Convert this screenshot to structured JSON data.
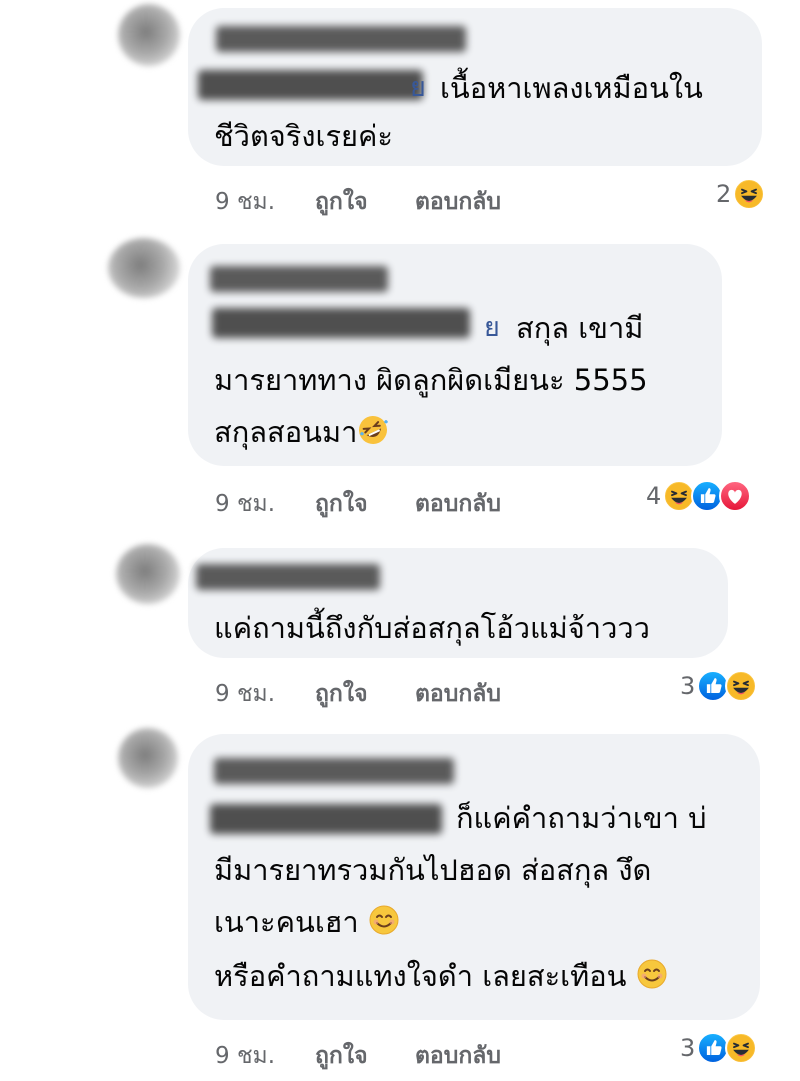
{
  "comments": [
    {
      "mention_tail": "ย",
      "lines": [
        "เนื้อหาเพลงเหมือนใน",
        "ชีวิตจริงเรยค่ะ"
      ],
      "time": "9 ชม.",
      "like_label": "ถูกใจ",
      "reply_label": "ตอบกลับ",
      "reaction_count": "2",
      "reactions": [
        "haha-icon"
      ]
    },
    {
      "mention_tail": "ย",
      "lines": [
        "สกุล เขามี",
        "มารยาททาง ผิดลูกผิดเมียนะ 5555",
        "สกุลสอนมา"
      ],
      "inline_emoji": "rofl-emoji-icon",
      "time": "9 ชม.",
      "like_label": "ถูกใจ",
      "reply_label": "ตอบกลับ",
      "reaction_count": "4",
      "reactions": [
        "haha-icon",
        "like-icon",
        "love-icon"
      ]
    },
    {
      "lines": [
        "แค่ถามนี้ถึงกับส่อสกุลโอ้วแม่จ้าววว"
      ],
      "time": "9 ชม.",
      "like_label": "ถูกใจ",
      "reply_label": "ตอบกลับ",
      "reaction_count": "3",
      "reactions": [
        "like-icon",
        "haha-icon"
      ]
    },
    {
      "lines": [
        "ก็แค่คำถามว่าเขา บ่",
        "มีมารยาทรวมกันไปฮอด ส่อสกุล งึด",
        "เนาะคนเฮา",
        "หรือคำถามแทงใจดำ เลยสะเทือน"
      ],
      "inline_emoji": "smile-emoji-icon",
      "time": "9 ชม.",
      "like_label": "ถูกใจ",
      "reply_label": "ตอบกลับ",
      "reaction_count": "3",
      "reactions": [
        "like-icon",
        "haha-icon"
      ]
    }
  ],
  "colors": {
    "bubble": "#f0f2f5",
    "meta_text": "#65676b",
    "mention": "#385898",
    "like_blue": "#1877f2",
    "love_red": "#f33e58",
    "haha_yellow": "#f7b125"
  }
}
